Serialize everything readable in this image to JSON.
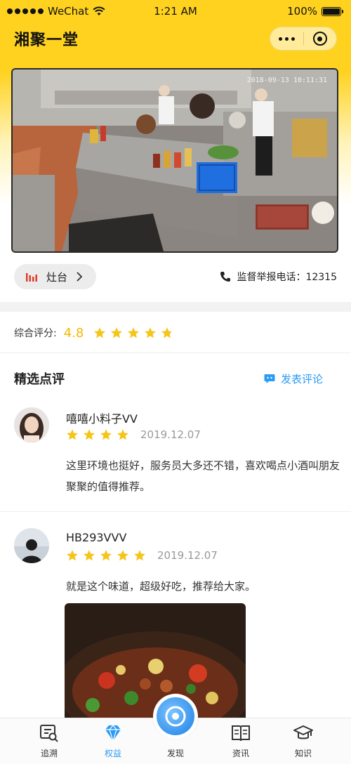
{
  "status_bar": {
    "carrier": "WeChat",
    "time": "1:21 AM",
    "battery": "100%",
    "battery_level": 1.0
  },
  "nav": {
    "title": "湘聚一堂"
  },
  "video": {
    "timestamp": "2018-09-13 10:11:31"
  },
  "stove": {
    "label": "灶台"
  },
  "hotline": {
    "label": "监督举报电话：12315"
  },
  "rating": {
    "label": "综合评分:",
    "score": "4.8",
    "stars": 4.8
  },
  "reviews": {
    "title": "精选点评",
    "post_label": "发表评论",
    "items": [
      {
        "name": "嘻嘻小料子VV",
        "stars": 4,
        "date": "2019.12.07",
        "text": "这里环境也挺好，服务员大多还不错，喜欢喝点小酒叫朋友聚聚的值得推荐。"
      },
      {
        "name": "HB293VVV",
        "stars": 5,
        "date": "2019.12.07",
        "text": "就是这个味道，超级好吃，推荐给大家。"
      }
    ]
  },
  "tabbar": {
    "tabs": [
      {
        "label": "追溯",
        "icon": "trace-icon"
      },
      {
        "label": "权益",
        "icon": "diamond-icon"
      },
      {
        "label": "发现",
        "icon": "discover-icon"
      },
      {
        "label": "资讯",
        "icon": "book-icon"
      },
      {
        "label": "知识",
        "icon": "graduation-cap-icon"
      }
    ],
    "active_index": 1
  },
  "colors": {
    "brand_yellow": "#FFD21F",
    "star": "#F5C518",
    "accent_blue": "#2b9bf4",
    "score": "#F5B800"
  }
}
